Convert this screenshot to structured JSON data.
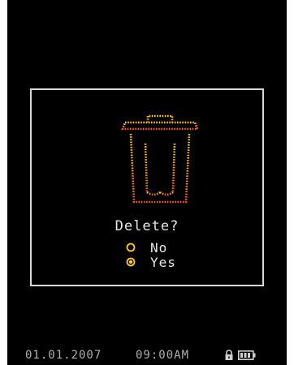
{
  "dialog": {
    "prompt": "Delete?",
    "icon": "trash-can-icon",
    "options": [
      {
        "label": "No",
        "selected": false
      },
      {
        "label": "Yes",
        "selected": true
      }
    ]
  },
  "status_bar": {
    "date": "01.01.2007",
    "time": "09:00AM",
    "icons": [
      "lock-icon",
      "battery-icon"
    ]
  },
  "colors": {
    "background": "#000000",
    "text": "#e8e8e8",
    "icon_top": "#ffd21a",
    "icon_bottom": "#ff5a1a",
    "radio": "#ffcc22",
    "status_text": "#b0b0b0"
  }
}
